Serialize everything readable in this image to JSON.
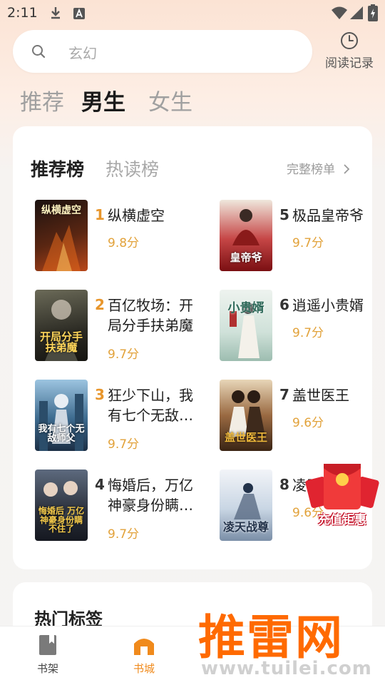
{
  "status_bar": {
    "time": "2:11",
    "icons": [
      "download-icon",
      "a-badge-icon",
      "wifi-icon",
      "signal-icon",
      "battery-icon"
    ]
  },
  "search": {
    "placeholder": "玄幻",
    "icon": "search-icon"
  },
  "history": {
    "label": "阅读记录",
    "icon": "clock-icon"
  },
  "top_tabs": [
    {
      "label": "推荐",
      "active": false
    },
    {
      "label": "男生",
      "active": true
    },
    {
      "label": "女生",
      "active": false
    }
  ],
  "ranking": {
    "tabs": [
      {
        "label": "推荐榜",
        "active": true
      },
      {
        "label": "热读榜",
        "active": false
      }
    ],
    "full_list_label": "完整榜单",
    "books": [
      {
        "rank": "1",
        "title": "纵横虚空",
        "score": "9.8分",
        "cover_text": "纵横虚空",
        "cover_color": "#3a1a10",
        "cover_accent": "#e0661c"
      },
      {
        "rank": "2",
        "title": "百亿牧场：开局分手扶弟魔",
        "score": "9.7分",
        "cover_text": "开局分手扶弟魔",
        "cover_color": "#2c2b24",
        "cover_accent": "#d6b36a"
      },
      {
        "rank": "3",
        "title": "狂少下山，我有七个无敌…",
        "score": "9.7分",
        "cover_text": "我有七个无敌师父",
        "cover_color": "#2a4a6c",
        "cover_accent": "#8fc3e8"
      },
      {
        "rank": "4",
        "title": "悔婚后，万亿神豪身份瞒…",
        "score": "9.7分",
        "cover_text": "悔婚后 万亿神豪身份瞒不住了",
        "cover_color": "#2a2f3a",
        "cover_accent": "#f2c84a"
      },
      {
        "rank": "5",
        "title": "极品皇帝爷",
        "score": "9.7分",
        "cover_text": "皇帝爷",
        "cover_color": "#b02222",
        "cover_accent": "#e8e4dc"
      },
      {
        "rank": "6",
        "title": "逍遥小贵婿",
        "score": "9.7分",
        "cover_text": "小贵婿",
        "cover_color": "#cfe1d9",
        "cover_accent": "#2f6a5a"
      },
      {
        "rank": "7",
        "title": "盖世医王",
        "score": "9.6分",
        "cover_text": "盖世医王",
        "cover_color": "#5a3a22",
        "cover_accent": "#f0b93a"
      },
      {
        "rank": "8",
        "title": "凌天",
        "score": "9.6分",
        "cover_text": "凌天战尊",
        "cover_color": "#c9d6e4",
        "cover_accent": "#22324a"
      }
    ]
  },
  "hot_tags": {
    "title": "热门标签"
  },
  "bottom_nav": [
    {
      "label": "书架",
      "icon": "bookshelf-icon",
      "active": false
    },
    {
      "label": "书城",
      "icon": "bookstore-icon",
      "active": true
    }
  ],
  "promo": {
    "label": "充值钜惠",
    "icon": "red-packet-icon"
  },
  "watermark": {
    "main": "推雷网",
    "sub": "www.tuilei.com"
  },
  "colors": {
    "accent": "#f08a1c",
    "score": "#e2a23a",
    "rank": "#e8962c",
    "watermark": "#ff6a00"
  }
}
